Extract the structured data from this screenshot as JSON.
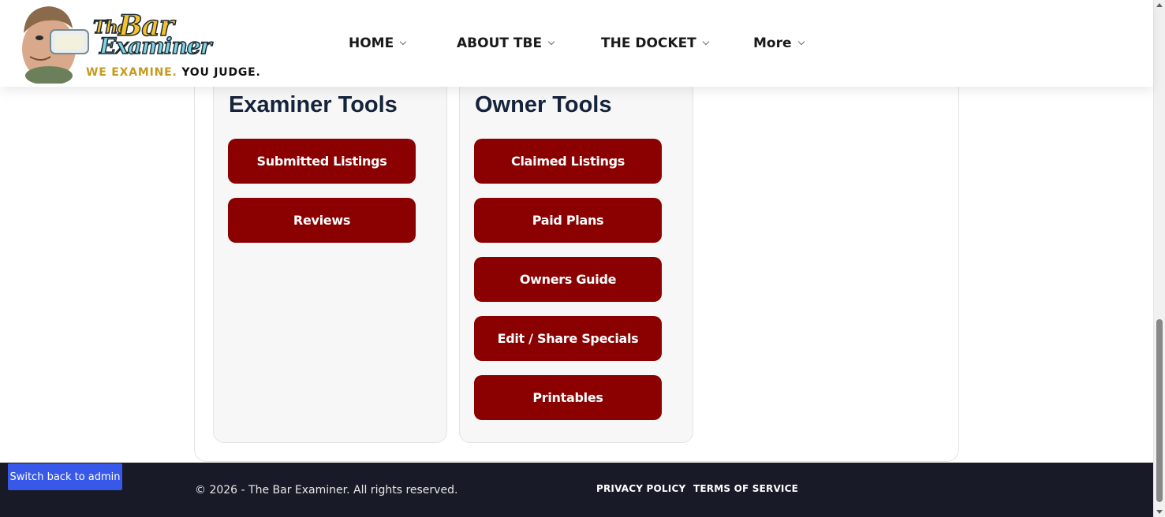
{
  "header": {
    "logo": {
      "text_the": "The",
      "text_bar": "Bar",
      "text_examiner": "Examiner"
    },
    "tagline": {
      "part1": "WE EXAMINE.",
      "part2": "YOU JUDGE."
    },
    "nav": [
      {
        "label": "HOME"
      },
      {
        "label": "ABOUT TBE"
      },
      {
        "label": "THE DOCKET"
      },
      {
        "label": "More"
      }
    ]
  },
  "examiner_tools": {
    "title": "Examiner Tools",
    "buttons": [
      "Submitted Listings",
      "Reviews"
    ]
  },
  "owner_tools": {
    "title": "Owner Tools",
    "buttons": [
      "Claimed Listings",
      "Paid Plans",
      "Owners Guide",
      "Edit / Share Specials",
      "Printables"
    ]
  },
  "admin_bar": {
    "switch_label": "Switch back to admin"
  },
  "footer": {
    "copyright": "© 2026 - The Bar Examiner. All rights reserved.",
    "links": [
      "PRIVACY POLICY",
      "TERMS OF SERVICE"
    ]
  },
  "colors": {
    "button_bg": "#8b0000",
    "heading": "#15243a",
    "footer_bg": "#181b27",
    "tagline_gold": "#c49a1e",
    "admin_blue": "#3858e9"
  }
}
